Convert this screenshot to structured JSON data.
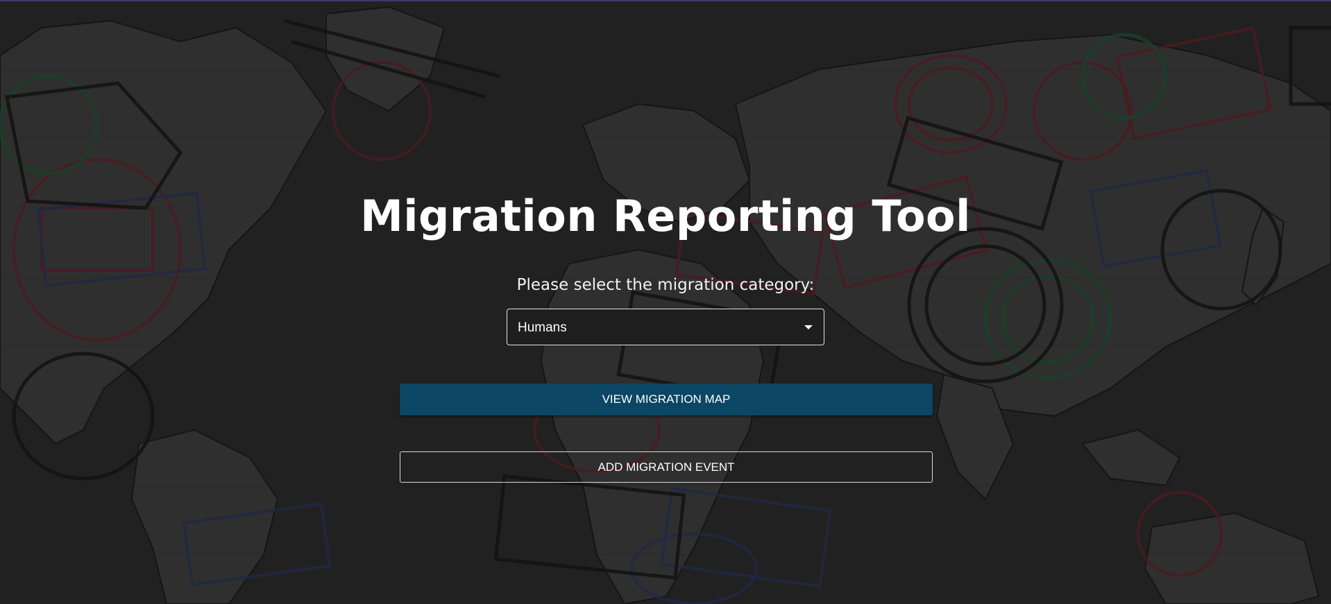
{
  "title": "Migration Reporting Tool",
  "subtitle": "Please select the migration category:",
  "category_select": {
    "selected": "Humans"
  },
  "buttons": {
    "view_map": "VIEW MIGRATION MAP",
    "add_event": "ADD MIGRATION EVENT"
  },
  "colors": {
    "primary_button": "#0b4764",
    "background": "#2a2a2a",
    "stamp_red": "#8a1d2a",
    "stamp_green": "#1f6b3a",
    "stamp_blue": "#2a3a7a"
  },
  "background_image": {
    "description_icon": "world-map-passport-stamps-image"
  }
}
